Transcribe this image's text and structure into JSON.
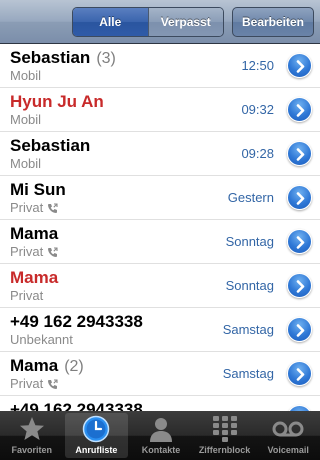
{
  "nav": {
    "segment": {
      "all_label": "Alle",
      "missed_label": "Verpasst",
      "selected": "Alle"
    },
    "edit_label": "Bearbeiten"
  },
  "calls": [
    {
      "name": "Sebastian",
      "count": "(3)",
      "type": "Mobil",
      "time": "12:50",
      "missed": false,
      "outgoing_icon": false
    },
    {
      "name": "Hyun Ju An",
      "count": "",
      "type": "Mobil",
      "time": "09:32",
      "missed": true,
      "outgoing_icon": false
    },
    {
      "name": "Sebastian",
      "count": "",
      "type": "Mobil",
      "time": "09:28",
      "missed": false,
      "outgoing_icon": false
    },
    {
      "name": "Mi Sun",
      "count": "",
      "type": "Privat",
      "time": "Gestern",
      "missed": false,
      "outgoing_icon": true
    },
    {
      "name": "Mama",
      "count": "",
      "type": "Privat",
      "time": "Sonntag",
      "missed": false,
      "outgoing_icon": true
    },
    {
      "name": "Mama",
      "count": "",
      "type": "Privat",
      "time": "Sonntag",
      "missed": true,
      "outgoing_icon": false
    },
    {
      "name": "+49 162 2943338",
      "count": "",
      "type": "Unbekannt",
      "time": "Samstag",
      "missed": false,
      "outgoing_icon": false
    },
    {
      "name": "Mama",
      "count": "(2)",
      "type": "Privat",
      "time": "Samstag",
      "missed": false,
      "outgoing_icon": true
    },
    {
      "name": "+49 162 2943338",
      "count": "",
      "type": "",
      "time": "",
      "missed": false,
      "outgoing_icon": false
    }
  ],
  "tabs": [
    {
      "label": "Favoriten",
      "icon": "star-icon",
      "active": false
    },
    {
      "label": "Anrufliste",
      "icon": "clock-icon",
      "active": true
    },
    {
      "label": "Kontakte",
      "icon": "person-icon",
      "active": false
    },
    {
      "label": "Ziffernblock",
      "icon": "keypad-icon",
      "active": false
    },
    {
      "label": "Voicemail",
      "icon": "voicemail-icon",
      "active": false
    }
  ],
  "colors": {
    "missed_call": "#c82a2a",
    "time_text": "#3366a6",
    "disclosure_blue": "#2f78d6",
    "navbar": "#8b9db5",
    "tabbar": "#141414"
  }
}
